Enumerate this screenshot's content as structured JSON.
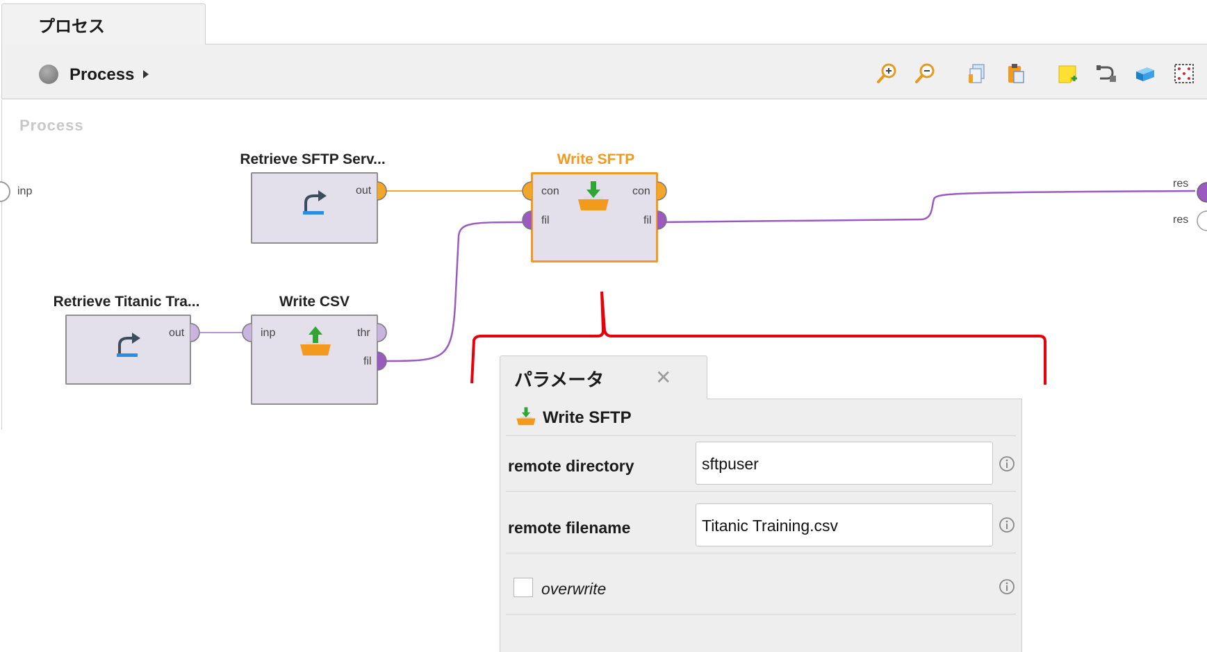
{
  "tab": {
    "label": "プロセス"
  },
  "breadcrumb": {
    "label": "Process"
  },
  "toolbar": {
    "icons": [
      "zoom-in-icon",
      "zoom-out-icon",
      "copy-icon",
      "paste-icon",
      "add-note-icon",
      "auto-wire-icon",
      "layers-icon",
      "fit-grid-icon"
    ]
  },
  "canvas": {
    "title": "Process",
    "input_port": "inp",
    "output_ports": [
      "res",
      "res"
    ]
  },
  "operators": {
    "retrieve_sftp": {
      "title": "Retrieve SFTP Serv...",
      "ports_out": [
        "out"
      ]
    },
    "retrieve_titanic": {
      "title": "Retrieve Titanic Tra...",
      "ports_out": [
        "out"
      ]
    },
    "write_csv": {
      "title": "Write CSV",
      "ports_in": [
        "inp"
      ],
      "ports_out": [
        "thr",
        "fil"
      ]
    },
    "write_sftp": {
      "title": "Write SFTP",
      "ports_in": [
        "con",
        "fil"
      ],
      "ports_out": [
        "con",
        "fil"
      ]
    }
  },
  "colors": {
    "selected": "#f39a1e",
    "connection_con": "#f3a72a",
    "connection_fil": "#9b59c2",
    "callout": "#e8000a"
  },
  "params": {
    "tab_label": "パラメータ",
    "operator_name": "Write SFTP",
    "rows": [
      {
        "label": "remote directory",
        "value": "sftpuser"
      },
      {
        "label": "remote filename",
        "value": "Titanic Training.csv"
      }
    ],
    "overwrite": {
      "label": "overwrite",
      "checked": false
    }
  }
}
